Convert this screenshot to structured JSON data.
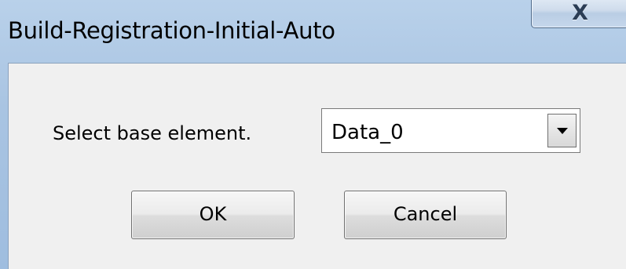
{
  "window": {
    "title": "Build-Registration-Initial-Auto",
    "close_glyph": "X"
  },
  "dialog": {
    "prompt_label": "Select base element.",
    "base_element": {
      "selected": "Data_0"
    },
    "ok_label": "OK",
    "cancel_label": "Cancel"
  },
  "colors": {
    "titlebar": "#b9d1ea",
    "client_background": "#f0f0f0"
  },
  "icons": {
    "close": "close-icon",
    "dropdown": "chevron-down-icon"
  }
}
